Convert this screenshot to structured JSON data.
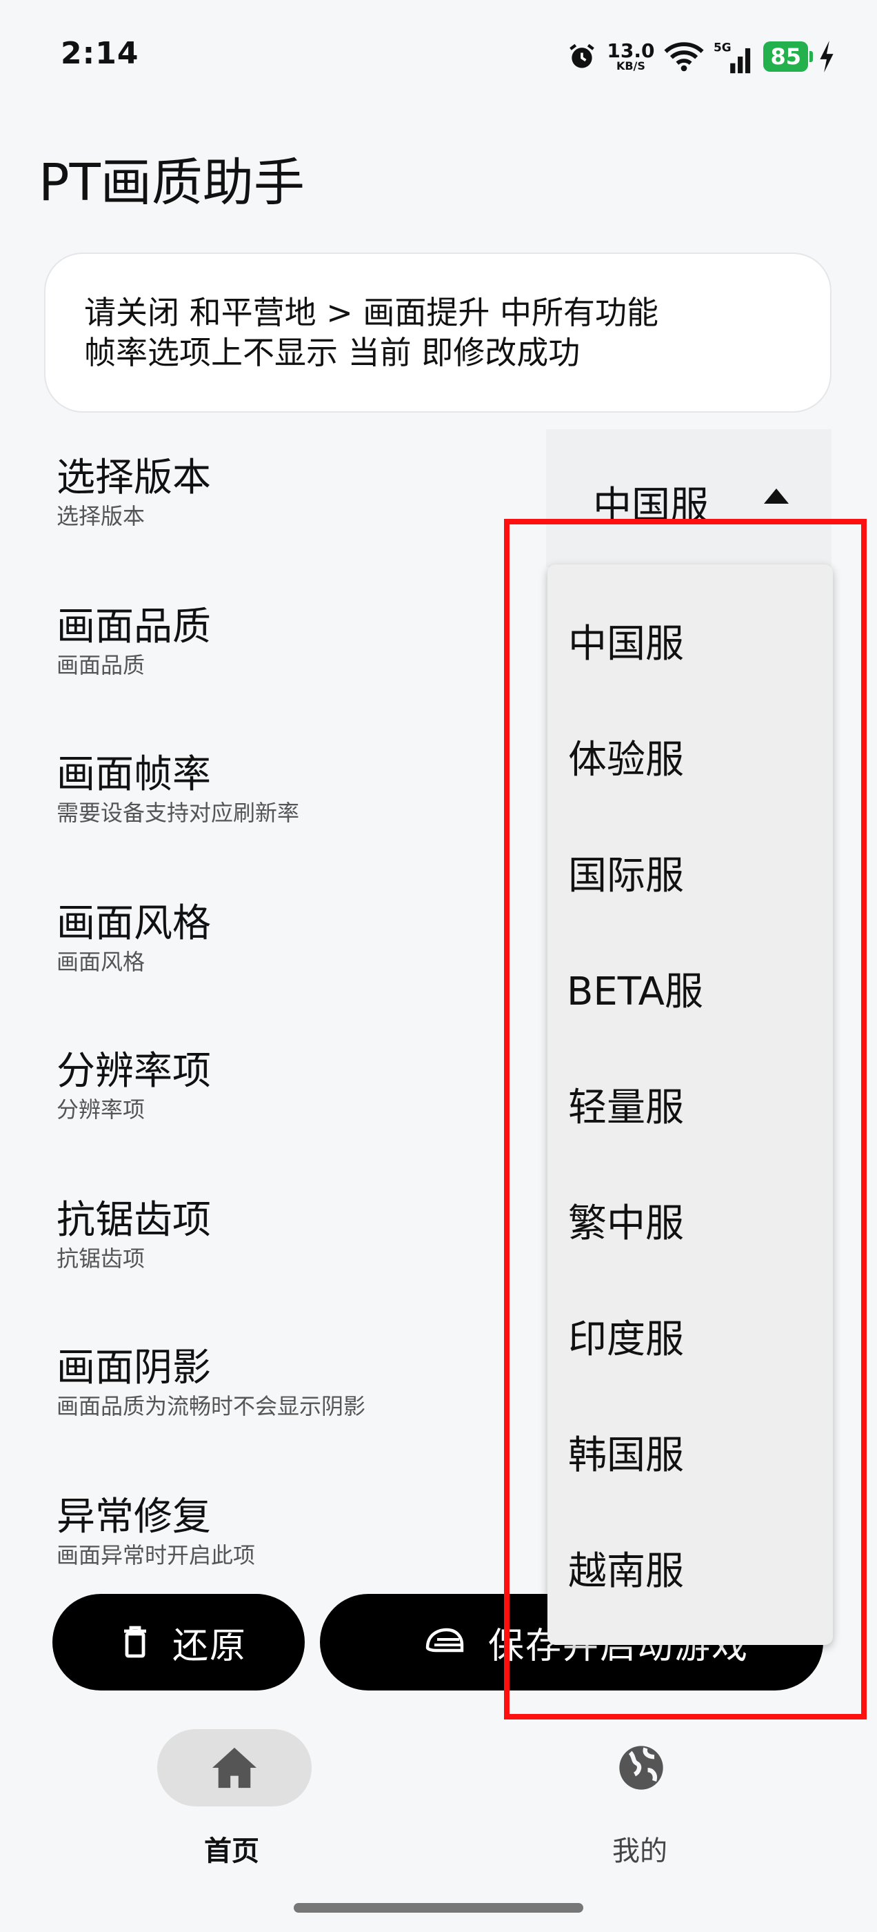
{
  "status_bar": {
    "time": "2:14",
    "net_speed_value": "13.0",
    "net_speed_unit": "KB/S",
    "battery": "85",
    "icons": [
      "alarm-icon",
      "wifi-icon",
      "signal-icon",
      "charging-icon"
    ]
  },
  "app": {
    "title": "PT画质助手"
  },
  "notice": {
    "line1": "请关闭 和平营地 > 画面提升 中所有功能",
    "line2": "帧率选项上不显示 当前 即修改成功"
  },
  "settings": [
    {
      "title": "选择版本",
      "subtitle": "选择版本"
    },
    {
      "title": "画面品质",
      "subtitle": "画面品质"
    },
    {
      "title": "画面帧率",
      "subtitle": "需要设备支持对应刷新率"
    },
    {
      "title": "画面风格",
      "subtitle": "画面风格"
    },
    {
      "title": "分辨率项",
      "subtitle": "分辨率项"
    },
    {
      "title": "抗锯齿项",
      "subtitle": "抗锯齿项"
    },
    {
      "title": "画面阴影",
      "subtitle": "画面品质为流畅时不会显示阴影"
    },
    {
      "title": "异常修复",
      "subtitle": "画面异常时开启此项"
    }
  ],
  "version_select": {
    "selected": "中国服",
    "options": [
      "中国服",
      "体验服",
      "国际服",
      "BETA服",
      "轻量服",
      "繁中服",
      "印度服",
      "韩国服",
      "越南服"
    ]
  },
  "actions": {
    "restore_label": "还原",
    "start_label": "保存并启动游戏"
  },
  "bottom_nav": {
    "home_label": "首页",
    "mine_label": "我的"
  },
  "colors": {
    "highlight": "#ff1010",
    "battery": "#22b14c",
    "button_bg": "#000000"
  }
}
